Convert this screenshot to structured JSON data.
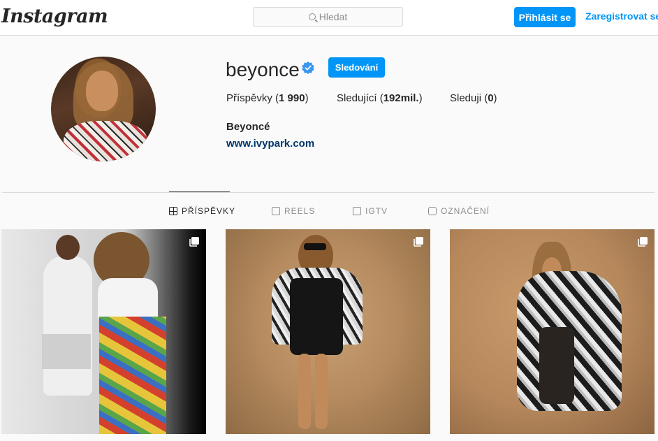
{
  "nav": {
    "logo": "Instagram",
    "search_placeholder": "Hledat",
    "login_label": "Přihlásit se",
    "signup_label": "Zaregistrovat se"
  },
  "profile": {
    "username": "beyonce",
    "verified": true,
    "follow_label": "Sledování",
    "stats": [
      {
        "prefix": "Příspěvky (",
        "value": "1 990",
        "suffix": ")"
      },
      {
        "prefix": "Sledující (",
        "value": "192mil.",
        "suffix": ")"
      },
      {
        "prefix": "Sleduji (",
        "value": "0",
        "suffix": ")"
      }
    ],
    "full_name": "Beyoncé",
    "website": "www.ivypark.com"
  },
  "tabs": [
    {
      "label": "PŘÍSPĚVKY",
      "icon": "grid-icon",
      "active": true
    },
    {
      "label": "REELS",
      "icon": "reels-icon",
      "active": false
    },
    {
      "label": "IGTV",
      "icon": "igtv-icon",
      "active": false
    },
    {
      "label": "OZNAČENÍ",
      "icon": "tagged-icon",
      "active": false
    }
  ],
  "posts": [
    {
      "type": "carousel"
    },
    {
      "type": "carousel"
    },
    {
      "type": "carousel"
    }
  ],
  "colors": {
    "accent": "#0095f6",
    "link": "#00376b",
    "text": "#262626",
    "muted": "#8e8e8e",
    "border": "#dbdbdb",
    "background": "#fafafa"
  }
}
